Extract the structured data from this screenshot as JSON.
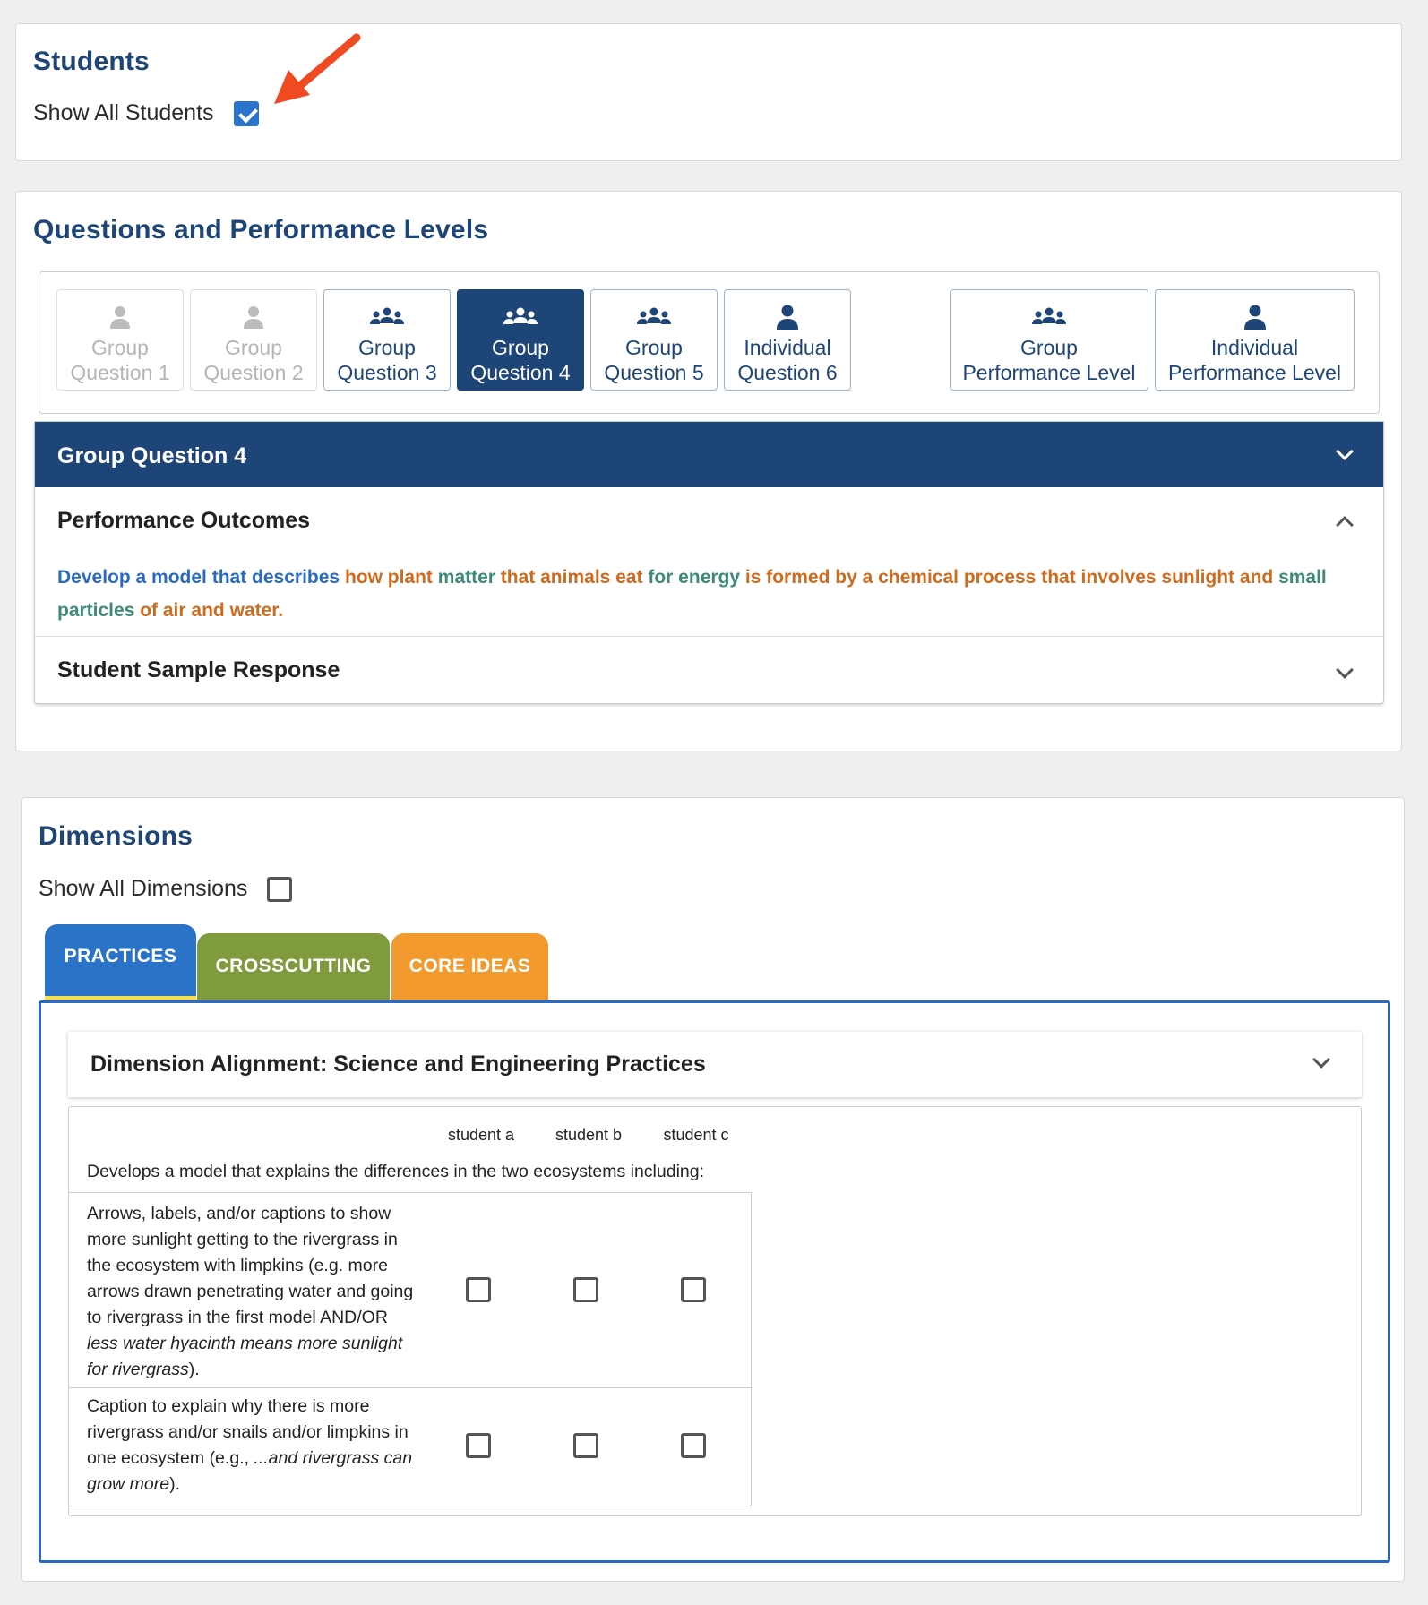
{
  "students": {
    "title": "Students",
    "show_all_label": "Show All Students",
    "show_all_checked": true
  },
  "questions": {
    "title": "Questions and Performance Levels",
    "tabs": [
      {
        "line1": "Group",
        "line2": "Question 1",
        "icon": "group-icon-small",
        "state": "disabled"
      },
      {
        "line1": "Group",
        "line2": "Question 2",
        "icon": "group-icon-small",
        "state": "disabled"
      },
      {
        "line1": "Group",
        "line2": "Question 3",
        "icon": "group-icon",
        "state": "normal"
      },
      {
        "line1": "Group",
        "line2": "Question 4",
        "icon": "group-icon",
        "state": "active"
      },
      {
        "line1": "Group",
        "line2": "Question 5",
        "icon": "group-icon",
        "state": "normal"
      },
      {
        "line1": "Individual",
        "line2": "Question 6",
        "icon": "person-icon",
        "state": "normal"
      },
      {
        "line1": "Group",
        "line2": "Performance Level",
        "icon": "group-icon",
        "state": "normal"
      },
      {
        "line1": "Individual",
        "line2": "Performance Level",
        "icon": "person-icon",
        "state": "normal"
      }
    ],
    "accordion": {
      "header": "Group Question 4",
      "performance_outcomes_title": "Performance Outcomes",
      "outcome_segments": [
        {
          "text": "Develop a model that describes ",
          "color": "blue"
        },
        {
          "text": "how plant ",
          "color": "orange"
        },
        {
          "text": "matter ",
          "color": "green"
        },
        {
          "text": "that animals eat ",
          "color": "orange"
        },
        {
          "text": "for energy ",
          "color": "green"
        },
        {
          "text": "is formed by a chemical process that involves sunlight and ",
          "color": "orange"
        },
        {
          "text": "small particles ",
          "color": "green"
        },
        {
          "text": "of air and water.",
          "color": "orange"
        }
      ],
      "sample_response_title": "Student Sample Response"
    }
  },
  "dimensions": {
    "title": "Dimensions",
    "show_all_label": "Show All Dimensions",
    "show_all_checked": false,
    "tabs": {
      "practices": "PRACTICES",
      "crosscutting": "CROSSCUTTING",
      "core_ideas": "CORE IDEAS"
    },
    "colors": {
      "practices": "#2a73c6",
      "crosscutting": "#7f9b3e",
      "core_ideas": "#f29a2e"
    },
    "alignment_title": "Dimension Alignment: Science and Engineering Practices",
    "columns": [
      "student a",
      "student b",
      "student c"
    ],
    "intro": "Develops a model that explains the differences in the two ecosystems including:",
    "rows": [
      {
        "plain": "Arrows, labels, and/or captions to show more sunlight getting to the rivergrass in the ecosystem with limpkins (e.g. more arrows drawn penetrating water and going to rivergrass in the first model AND/OR ",
        "italic": "less water hyacinth means more sunlight for rivergrass",
        "end": ").",
        "checks": [
          false,
          false,
          false
        ]
      },
      {
        "plain": "Caption to explain why there is more rivergrass and/or snails and/or limpkins in one ecosystem (e.g., ",
        "italic": "...and rivergrass can grow more",
        "end": ").",
        "checks": [
          false,
          false,
          false
        ]
      }
    ]
  }
}
